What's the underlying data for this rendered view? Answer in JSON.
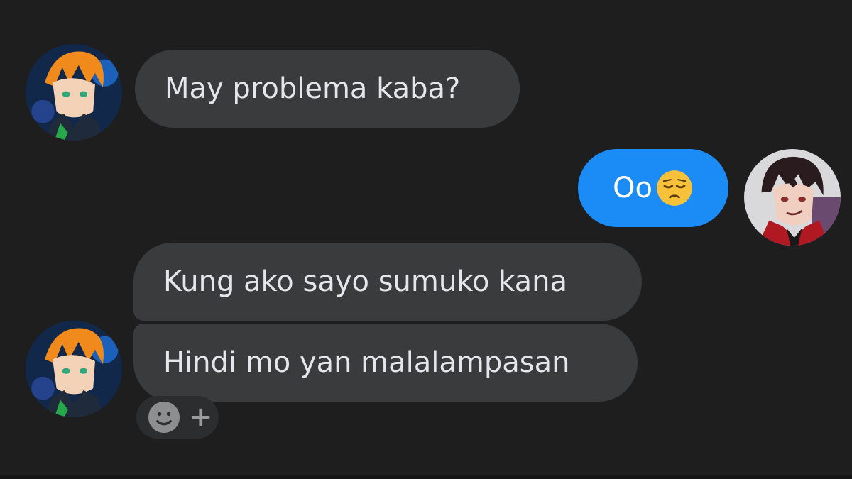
{
  "conversation": {
    "messages": [
      {
        "sender": "contact",
        "text": "May problema kaba?"
      },
      {
        "sender": "me",
        "text": "Oo",
        "emoji": "pensive-face-emoji"
      },
      {
        "sender": "contact",
        "text": "Kung ako sayo sumuko kana"
      },
      {
        "sender": "contact",
        "text": "Hindi mo yan malalampasan"
      }
    ],
    "reaction_button": {
      "icon": "smiley-face-icon",
      "plus_label": "+"
    }
  },
  "colors": {
    "background": "#1e1e1f",
    "incoming_bubble": "#3a3b3c",
    "outgoing_bubble": "#1b8cf5",
    "incoming_text": "#e4e6eb"
  }
}
